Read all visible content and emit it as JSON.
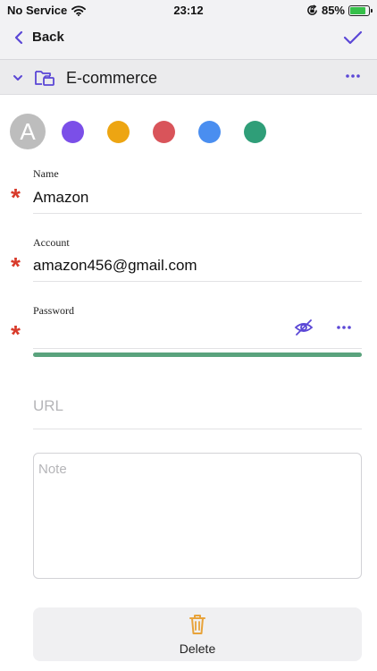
{
  "status": {
    "carrier": "No Service",
    "time": "23:12",
    "battery_percent": "85%",
    "battery_level": 0.85,
    "icons": [
      "wifi-icon",
      "orientation-lock-icon",
      "battery-charging-icon"
    ]
  },
  "nav": {
    "back_label": "Back",
    "icons": [
      "chevron-left-icon",
      "checkmark-icon"
    ]
  },
  "group": {
    "name": "E-commerce",
    "icons": [
      "chevron-down-icon",
      "folder-icon",
      "more-icon"
    ]
  },
  "avatar": {
    "letter": "A",
    "color": "#bdbdbd"
  },
  "color_swatches": [
    {
      "name": "purple",
      "color": "#7b4fe8"
    },
    {
      "name": "orange",
      "color": "#eda512"
    },
    {
      "name": "red",
      "color": "#d9545a"
    },
    {
      "name": "blue",
      "color": "#4a8ef0"
    },
    {
      "name": "green",
      "color": "#2f9e78"
    }
  ],
  "fields": {
    "name": {
      "label": "Name",
      "value": "Amazon",
      "required_mark": "*"
    },
    "account": {
      "label": "Account",
      "value": "amazon456@gmail.com",
      "required_mark": "*"
    },
    "password": {
      "label": "Password",
      "value": "",
      "required_mark": "*",
      "strength": 1.0,
      "strength_color": "#5aa37d",
      "icons": [
        "eye-slash-icon",
        "more-icon"
      ]
    },
    "url": {
      "placeholder": "URL"
    },
    "note": {
      "placeholder": "Note"
    }
  },
  "delete": {
    "label": "Delete",
    "icon": "trash-icon"
  },
  "colors": {
    "accent": "#5b47d6",
    "required": "#d83a2a",
    "delete_icon": "#e8a33a"
  }
}
